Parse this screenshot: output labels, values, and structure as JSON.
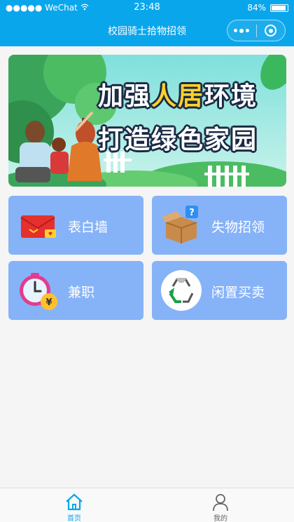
{
  "status": {
    "carrier": "●●●●● WeChat",
    "time": "23:48",
    "battery": "84%",
    "battery_level": 0.84
  },
  "nav": {
    "title": "校园骑士拾物招领"
  },
  "banner": {
    "line1_a": "加强",
    "line1_hl": "人居",
    "line1_b": "环境",
    "line2": "打造绿色家园"
  },
  "menu": [
    {
      "label": "表白墙",
      "icon": "red-envelope-icon"
    },
    {
      "label": "失物招领",
      "icon": "question-box-icon"
    },
    {
      "label": "兼职",
      "icon": "clock-money-icon"
    },
    {
      "label": "闲置买卖",
      "icon": "recycle-icon"
    }
  ],
  "tabs": [
    {
      "label": "首页",
      "icon": "home-icon",
      "active": true
    },
    {
      "label": "我的",
      "icon": "user-icon",
      "active": false
    }
  ],
  "colors": {
    "primary": "#0aa6ec",
    "card": "#86b2f8",
    "highlight": "#ffd12a"
  }
}
